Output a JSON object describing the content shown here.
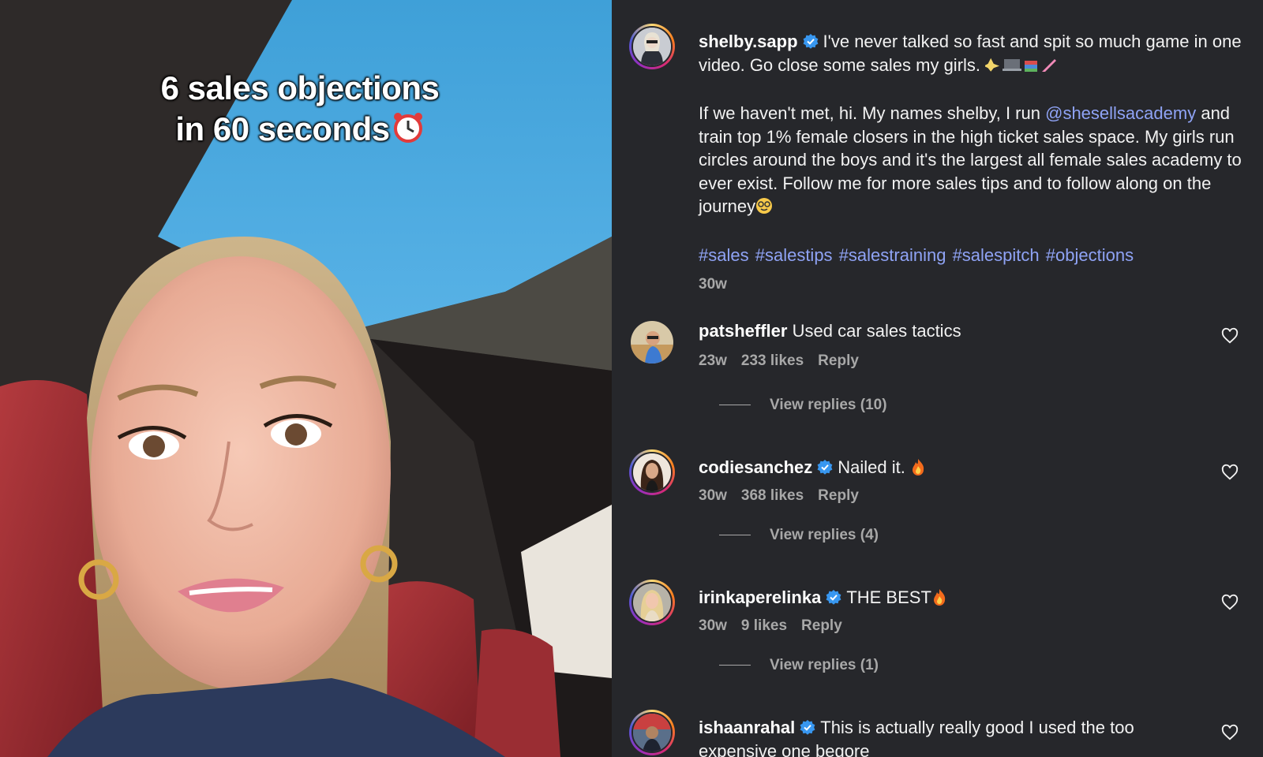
{
  "video": {
    "caption_line1": "6 sales objections",
    "caption_line2": "in 60 seconds"
  },
  "post": {
    "username": "shelby.sapp",
    "verified": true,
    "caption_p1": "I've never talked so fast and spit so much game in one video. Go close some sales my girls.",
    "caption_p2_intro": "If we haven't met, hi. My names shelby, I run",
    "mention": "@shesellsacademy",
    "caption_p2_rest": "and train top 1% female closers in the high ticket sales space. My girls run circles around the boys and it's the largest all female sales academy to ever exist. Follow me for more sales tips and to follow along on the journey",
    "hashtags": [
      "#sales",
      "#salestips",
      "#salestraining",
      "#salespitch",
      "#objections"
    ],
    "age": "30w"
  },
  "comments": [
    {
      "username": "patsheffler",
      "verified": false,
      "text": "Used car sales tactics",
      "age": "23w",
      "likes": "233 likes",
      "reply": "Reply",
      "view_replies": "View replies (10)"
    },
    {
      "username": "codiesanchez",
      "verified": true,
      "text": "Nailed it.",
      "emoji": "fire",
      "age": "30w",
      "likes": "368 likes",
      "reply": "Reply",
      "view_replies": "View replies (4)"
    },
    {
      "username": "irinkaperelinka",
      "verified": true,
      "text": "THE BEST",
      "emoji": "fire",
      "age": "30w",
      "likes": "9 likes",
      "reply": "Reply",
      "view_replies": "View replies (1)"
    },
    {
      "username": "ishaanrahal",
      "verified": true,
      "text": "This is actually really good I used the too expensive one begore"
    }
  ],
  "icons": {
    "verified": "verified-badge-icon",
    "heart": "heart-outline-icon",
    "clock": "alarm-clock-emoji",
    "fire": "fire-emoji"
  },
  "colors": {
    "panel_bg": "#26272b",
    "link": "#8fa3f5",
    "meta": "#a8a8a8",
    "verified": "#3897f0"
  }
}
